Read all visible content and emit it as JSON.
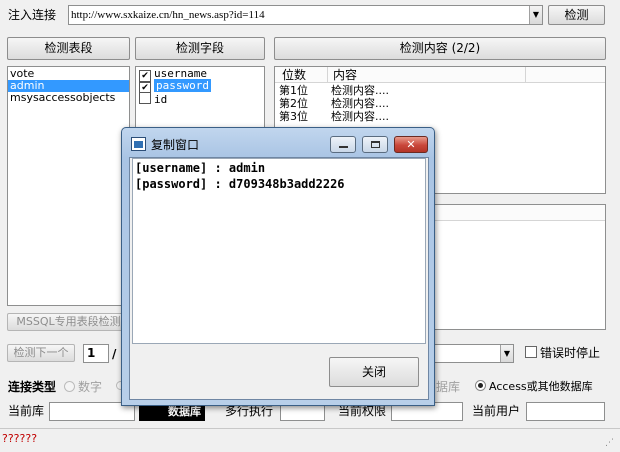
{
  "top": {
    "url_label": "注入连接",
    "url_value": "http://www.sxkaize.cn/hn_news.asp?id=114",
    "detect_button": "检测"
  },
  "panels": {
    "tables_button": "检测表段",
    "fields_button": "检测字段",
    "content_button": "检测内容 (2/2)"
  },
  "tables": [
    "vote",
    "admin",
    "msysaccessobjects"
  ],
  "fields": [
    {
      "name": "username",
      "checked": true,
      "selected": false
    },
    {
      "name": "password",
      "checked": true,
      "selected": true
    },
    {
      "name": "id",
      "checked": false,
      "selected": false
    }
  ],
  "content_table": {
    "headers": [
      "位数",
      "内容"
    ],
    "rows": [
      {
        "pos": "第1位",
        "text": "检测内容...."
      },
      {
        "pos": "第2位",
        "text": "检测内容...."
      },
      {
        "pos": "第3位",
        "text": "检测内容...."
      }
    ]
  },
  "mssql_button": "MSSQL专用表段检测",
  "nav": {
    "next_button": "检测下一个",
    "page_value": "1",
    "page_sep": "/",
    "error_stop_label": "错误时停止"
  },
  "connection": {
    "label": "连接类型",
    "numeric_option": "数字",
    "db_suffix": "据库",
    "access_option": "Access或其他数据库"
  },
  "info": {
    "current_db_label": "当前库",
    "multi_exec_label": "多行执行",
    "current_perm_label": "当前权限",
    "current_user_label": "当前用户",
    "badge_text": "数据库"
  },
  "status_text": "??????",
  "dialog": {
    "title": "复制窗口",
    "lines": [
      "[username] : admin",
      "[password] : d709348b3add2226"
    ],
    "close_button": "关闭"
  },
  "colors": {
    "selection": "#3399ff",
    "close_red": "#c9473a",
    "status_text": "#c00000"
  }
}
